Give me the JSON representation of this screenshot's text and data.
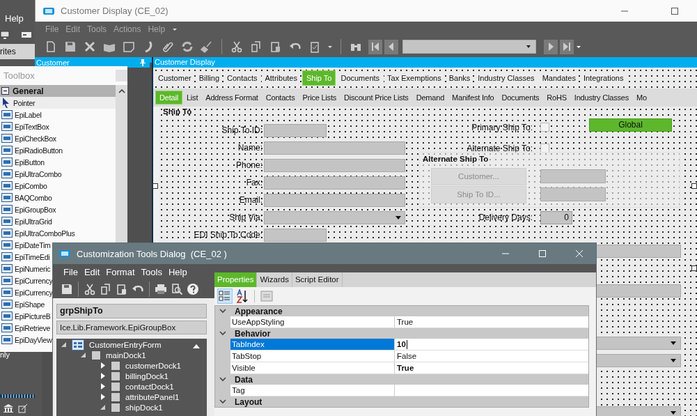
{
  "desktop": {
    "menu": "Help",
    "tab": "rites",
    "panel_text": "nly"
  },
  "window": {
    "title": "Customer Display (CE_02)",
    "menu": [
      {
        "label": "File",
        "disabled": true
      },
      {
        "label": "Edit",
        "disabled": true
      },
      {
        "label": "Tools",
        "disabled": true
      },
      {
        "label": "Actions",
        "disabled": true
      },
      {
        "label": "Help",
        "disabled": true
      }
    ]
  },
  "customer_panel": {
    "title": "Customer"
  },
  "toolbox": {
    "title": "Toolbox",
    "group": {
      "label": "General",
      "expanded": true
    },
    "items": [
      {
        "label": "Pointer",
        "selected": true
      },
      {
        "label": "EpiLabel",
        "selected": false
      },
      {
        "label": "EpiTextBox",
        "selected": false
      },
      {
        "label": "EpiCheckBox",
        "selected": false
      },
      {
        "label": "EpiRadioButton",
        "selected": false
      },
      {
        "label": "EpiButton",
        "selected": false
      },
      {
        "label": "EpiUltraCombo",
        "selected": false
      },
      {
        "label": "EpiCombo",
        "selected": false
      },
      {
        "label": "BAQCombo",
        "selected": false
      },
      {
        "label": "EpiGroupBox",
        "selected": false
      },
      {
        "label": "EpiUltraGrid",
        "selected": false
      },
      {
        "label": "EpiUltraComboPlus",
        "selected": false
      },
      {
        "label": "EpiDateTim",
        "selected": false
      },
      {
        "label": "EpiTimeEdi",
        "selected": false
      },
      {
        "label": "EpiNumeric",
        "selected": false
      },
      {
        "label": "EpiCurrency",
        "selected": false
      },
      {
        "label": "EpiCurrency",
        "selected": false
      },
      {
        "label": "EpiShape",
        "selected": false
      },
      {
        "label": "EpiPictureB",
        "selected": false
      },
      {
        "label": "EpiRetrieve",
        "selected": false
      },
      {
        "label": "EpiDayView",
        "selected": false
      }
    ]
  },
  "form": {
    "title": "Customer Display",
    "tabs": [
      {
        "label": "Customer",
        "selected": false
      },
      {
        "label": "Billing",
        "selected": false
      },
      {
        "label": "Contacts",
        "selected": false
      },
      {
        "label": "Attributes",
        "selected": false
      },
      {
        "label": "Ship To",
        "selected": true
      },
      {
        "label": "Documents",
        "selected": false
      },
      {
        "label": "Tax Exemptions",
        "selected": false
      },
      {
        "label": "Banks",
        "selected": false
      },
      {
        "label": "Industry Classes",
        "selected": false
      },
      {
        "label": "Mandates",
        "selected": false
      },
      {
        "label": "Integrations",
        "selected": false
      }
    ],
    "subtabs": [
      {
        "label": "Detail",
        "selected": true
      },
      {
        "label": "List",
        "selected": false
      },
      {
        "label": "Address Format",
        "selected": false
      },
      {
        "label": "Contacts",
        "selected": false
      },
      {
        "label": "Price Lists",
        "selected": false
      },
      {
        "label": "Discount Price Lists",
        "selected": false
      },
      {
        "label": "Demand",
        "selected": false
      },
      {
        "label": "Manifest Info",
        "selected": false
      },
      {
        "label": "Documents",
        "selected": false
      },
      {
        "label": "RoHS",
        "selected": false
      },
      {
        "label": "Industry Classes",
        "selected": false
      },
      {
        "label": "Mo",
        "selected": false
      }
    ],
    "group_title": "Ship To",
    "fields": [
      {
        "label": "Ship To ID:",
        "kind": "short"
      },
      {
        "label": "Name:",
        "kind": "text"
      },
      {
        "label": "Phone:",
        "kind": "text"
      },
      {
        "label": "Fax:",
        "kind": "text"
      },
      {
        "label": "Email:",
        "kind": "text"
      },
      {
        "label": "Ship Via:",
        "kind": "combo"
      },
      {
        "label": "EDI Ship To Code:",
        "kind": "short"
      }
    ],
    "checkboxes": [
      {
        "label": "Primary Ship To:",
        "checked": false
      },
      {
        "label": "Alternate Ship To:",
        "checked": false
      }
    ],
    "global_button": "Global",
    "alternate_group": {
      "title": "Alternate Ship To",
      "buttons": [
        {
          "label": "Customer...",
          "disabled": true
        },
        {
          "label": "Ship To ID...",
          "disabled": true
        }
      ]
    },
    "delivery_days": {
      "label": "Delivery Days:",
      "value": "0"
    }
  },
  "dialog": {
    "title": "Customization Tools Dialog  (CE_02 )",
    "menu": [
      "File",
      "Edit",
      "Format",
      "Tools",
      "Help"
    ],
    "control_name": "grpShipTo",
    "control_type": "Ice.Lib.Framework.EpiGroupBox",
    "tree": [
      {
        "label": "CustomerEntryForm",
        "expanded": true,
        "children": [
          {
            "label": "mainDock1",
            "expanded": true,
            "children": [
              {
                "label": "customerDock1",
                "expanded": false
              },
              {
                "label": "billingDock1",
                "expanded": false
              },
              {
                "label": "contactDock1",
                "expanded": false
              },
              {
                "label": "attributePanel1",
                "expanded": false
              },
              {
                "label": "shipDock1",
                "expanded": true
              }
            ]
          }
        ]
      }
    ],
    "tabs": [
      {
        "label": "Properties",
        "selected": true
      },
      {
        "label": "Wizards",
        "selected": false
      },
      {
        "label": "Script Editor",
        "selected": false
      }
    ],
    "categories": [
      {
        "name": "Appearance",
        "expanded": true,
        "properties": [
          {
            "name": "UseAppStyling",
            "value": "True",
            "selected": false
          }
        ]
      },
      {
        "name": "Behavior",
        "expanded": true,
        "properties": [
          {
            "name": "TabIndex",
            "value": "10",
            "modified": true,
            "selected": true
          },
          {
            "name": "TabStop",
            "value": "False",
            "selected": false
          },
          {
            "name": "Visible",
            "value": "True",
            "modified": true,
            "selected": false
          }
        ]
      },
      {
        "name": "Data",
        "expanded": true,
        "properties": [
          {
            "name": "Tag",
            "selected": false
          }
        ]
      },
      {
        "name": "Layout",
        "expanded": true
      }
    ]
  }
}
